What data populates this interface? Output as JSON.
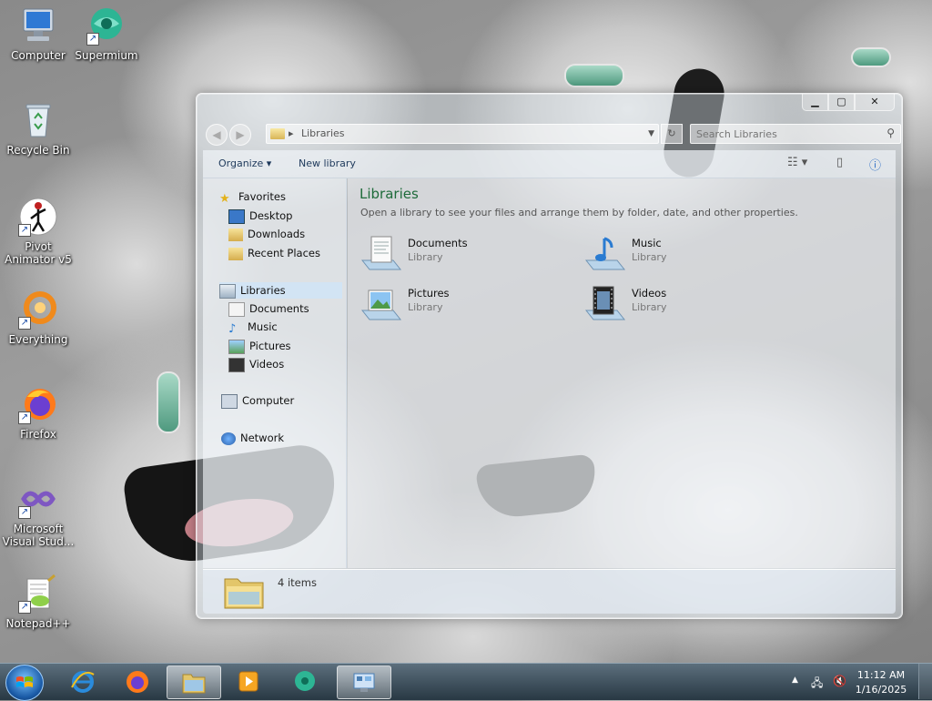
{
  "desktop": {
    "icons": [
      {
        "label": "Computer",
        "icon": "computer-icon"
      },
      {
        "label": "Supermium",
        "icon": "supermium-icon"
      },
      {
        "label": "Recycle Bin",
        "icon": "recycle-bin-icon"
      },
      {
        "label": "Pivot Animator v5",
        "icon": "pivot-animator-icon"
      },
      {
        "label": "Everything",
        "icon": "everything-icon"
      },
      {
        "label": "Firefox",
        "icon": "firefox-icon"
      },
      {
        "label": "Microsoft Visual Stud...",
        "icon": "visual-studio-icon"
      },
      {
        "label": "Notepad++",
        "icon": "notepad-plus-plus-icon"
      }
    ]
  },
  "window": {
    "address": {
      "crumb": "Libraries"
    },
    "search": {
      "placeholder": "Search Libraries"
    },
    "toolbar": {
      "organize": "Organize",
      "new_library": "New library"
    },
    "nav": {
      "favorites": "Favorites",
      "desktop": "Desktop",
      "downloads": "Downloads",
      "recent_places": "Recent Places",
      "libraries": "Libraries",
      "documents": "Documents",
      "music": "Music",
      "pictures": "Pictures",
      "videos": "Videos",
      "computer": "Computer",
      "network": "Network"
    },
    "content": {
      "heading": "Libraries",
      "subtitle": "Open a library to see your files and arrange them by folder, date, and other properties.",
      "libraries": [
        {
          "name": "Documents",
          "kind": "Library"
        },
        {
          "name": "Music",
          "kind": "Library"
        },
        {
          "name": "Pictures",
          "kind": "Library"
        },
        {
          "name": "Videos",
          "kind": "Library"
        }
      ]
    },
    "details": {
      "count": "4 items"
    }
  },
  "taskbar": {
    "clock_time": "11:12 AM",
    "clock_date": "1/16/2025",
    "items": [
      "internet-explorer-icon",
      "firefox-icon",
      "windows-explorer-icon",
      "media-player-icon",
      "supermium-icon",
      "control-panel-icon"
    ]
  }
}
